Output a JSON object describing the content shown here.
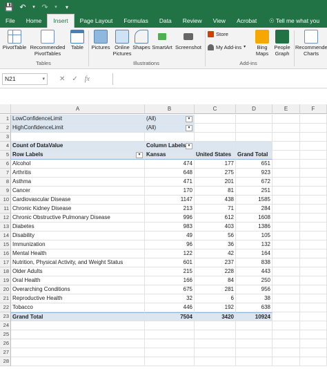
{
  "ribbon_tabs": [
    "File",
    "Home",
    "Insert",
    "Page Layout",
    "Formulas",
    "Data",
    "Review",
    "View",
    "Acrobat"
  ],
  "active_tab": "Insert",
  "tell_me": "Tell me what you",
  "ribbon": {
    "pivottable": "PivotTable",
    "recommended_pivottables": "Recommended PivotTables",
    "table": "Table",
    "pictures": "Pictures",
    "online_pictures": "Online Pictures",
    "shapes": "Shapes",
    "smartart": "SmartArt",
    "screenshot": "Screenshot",
    "store": "Store",
    "my_addins": "My Add-ins",
    "bing_maps": "Bing Maps",
    "people_graph": "People Graph",
    "recommended_charts": "Recommended Charts",
    "group_tables": "Tables",
    "group_illustrations": "Illustrations",
    "group_addins": "Add-ins"
  },
  "formula_bar": {
    "name_box": "N21",
    "fx": "fx",
    "value": ""
  },
  "columns": [
    "A",
    "B",
    "C",
    "D",
    "E",
    "F"
  ],
  "filters": [
    {
      "label": "LowConfidenceLimit",
      "value": "(All)"
    },
    {
      "label": "HighConfidenceLimit",
      "value": "(All)"
    }
  ],
  "pivot": {
    "count_label": "Count of DataValue",
    "column_labels": "Column Labels",
    "row_labels": "Row Labels",
    "headers": [
      "Kansas",
      "United States",
      "Grand Total"
    ],
    "rows": [
      {
        "label": "Alcohol",
        "values": [
          "474",
          "177",
          "651"
        ]
      },
      {
        "label": "Arthritis",
        "values": [
          "648",
          "275",
          "923"
        ]
      },
      {
        "label": "Asthma",
        "values": [
          "471",
          "201",
          "672"
        ]
      },
      {
        "label": "Cancer",
        "values": [
          "170",
          "81",
          "251"
        ]
      },
      {
        "label": "Cardiovascular Disease",
        "values": [
          "1147",
          "438",
          "1585"
        ]
      },
      {
        "label": "Chronic Kidney Disease",
        "values": [
          "213",
          "71",
          "284"
        ]
      },
      {
        "label": "Chronic Obstructive Pulmonary Disease",
        "values": [
          "996",
          "612",
          "1608"
        ]
      },
      {
        "label": "Diabetes",
        "values": [
          "983",
          "403",
          "1386"
        ]
      },
      {
        "label": "Disability",
        "values": [
          "49",
          "56",
          "105"
        ]
      },
      {
        "label": "Immunization",
        "values": [
          "96",
          "36",
          "132"
        ]
      },
      {
        "label": "Mental Health",
        "values": [
          "122",
          "42",
          "164"
        ]
      },
      {
        "label": "Nutrition, Physical Activity, and Weight Status",
        "values": [
          "601",
          "237",
          "838"
        ]
      },
      {
        "label": "Older Adults",
        "values": [
          "215",
          "228",
          "443"
        ]
      },
      {
        "label": "Oral Health",
        "values": [
          "166",
          "84",
          "250"
        ]
      },
      {
        "label": "Overarching Conditions",
        "values": [
          "675",
          "281",
          "956"
        ]
      },
      {
        "label": "Reproductive Health",
        "values": [
          "32",
          "6",
          "38"
        ]
      },
      {
        "label": "Tobacco",
        "values": [
          "446",
          "192",
          "638"
        ]
      }
    ],
    "grand_total": {
      "label": "Grand Total",
      "values": [
        "7504",
        "3420",
        "10924"
      ]
    }
  },
  "row_numbers": [
    "1",
    "2",
    "3",
    "4",
    "5",
    "6",
    "7",
    "8",
    "9",
    "10",
    "11",
    "12",
    "13",
    "14",
    "15",
    "16",
    "17",
    "18",
    "19",
    "20",
    "21",
    "22",
    "23",
    "24",
    "25",
    "26",
    "27",
    "28"
  ]
}
